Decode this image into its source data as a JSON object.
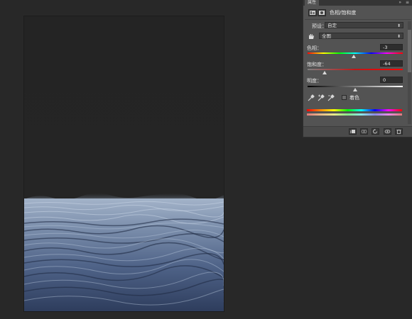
{
  "panel": {
    "tab_label": "属性",
    "tab_controls": "» ≡",
    "adjustment_title": "色相/饱和度",
    "preset_label": "预设：",
    "preset_value": "自定",
    "channel_value": "全图",
    "hue_label": "色相：",
    "hue_value": "-3",
    "hue_level": -3,
    "saturation_label": "饱和度：",
    "saturation_value": "-64",
    "saturation_level": -64,
    "lightness_label": "明度：",
    "lightness_value": "0",
    "lightness_level": 0,
    "colorize_label": "着色",
    "colorize_checked": false,
    "icons": [
      "hue-saturation-layer-icon",
      "layer-mask-icon",
      "target-adjustment-hand-icon",
      "eyedropper-icon",
      "eyedropper-plus-icon",
      "eyedropper-minus-icon",
      "clip-to-layer-icon",
      "view-previous-state-icon",
      "reset-icon",
      "visibility-eye-icon",
      "delete-icon"
    ]
  },
  "colors": {
    "workspace": "#282828",
    "panel_bg": "#535353",
    "water_deep": "#2c3a58",
    "water_light": "#9fb2cc"
  }
}
